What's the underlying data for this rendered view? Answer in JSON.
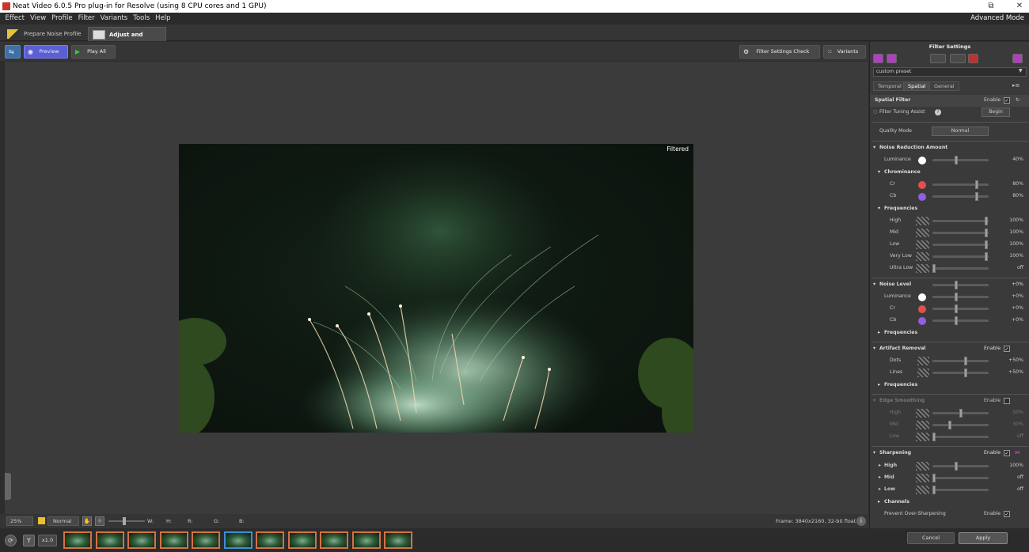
{
  "window": {
    "title": "Neat Video 6.0.5 Pro plug-in for Resolve (using 8 CPU cores and 1 GPU)",
    "restore_glyph": "⧉",
    "close_glyph": "✕"
  },
  "menu": [
    "Effect",
    "View",
    "Profile",
    "Filter",
    "Variants",
    "Tools",
    "Help"
  ],
  "mode_label": "Advanced Mode",
  "tabs": {
    "prepare": "Prepare Noise Profile",
    "adjust": "Adjust and Preview"
  },
  "toolbar": {
    "preview": "Preview",
    "play_all": "Play All",
    "filter_check": "Filter Settings Check",
    "variants": "Variants"
  },
  "viewer": {
    "label": "Filtered"
  },
  "bottom": {
    "zoom": "25%",
    "mode": "Normal",
    "w": "W:",
    "h": "H:",
    "r": "R:",
    "g": "G:",
    "b": "B:",
    "frame": "Frame: 3840x2160, 32-bit float"
  },
  "filmstrip": {
    "speed": "x1.0",
    "thumb_count": 11,
    "selected_index": 5,
    "cancel": "Cancel",
    "apply": "Apply"
  },
  "panel": {
    "header": "Filter Settings",
    "preset": "custom preset",
    "tabs": [
      "Temporal",
      "Spatial",
      "General"
    ],
    "spatial_filter": "Spatial Filter",
    "enable": "Enable",
    "tuning": "Filter Tuning Assist",
    "begin": "Begin",
    "quality_label": "Quality Mode",
    "quality_value": "Normal",
    "nr_header": "Noise Reduction Amount",
    "luminance": "Luminance",
    "lum_value": "40%",
    "chrominance": "Chrominance",
    "cr": "Cr",
    "cr_value": "80%",
    "cb": "Cb",
    "cb_value": "80%",
    "frequencies": "Frequencies",
    "freq": [
      {
        "l": "High",
        "v": "100%"
      },
      {
        "l": "Mid",
        "v": "100%"
      },
      {
        "l": "Low",
        "v": "100%"
      },
      {
        "l": "Very Low",
        "v": "100%"
      },
      {
        "l": "Ultra Low",
        "v": "off"
      }
    ],
    "noise_level": "Noise Level",
    "nl_value": "+0%",
    "nl_rows": [
      {
        "l": "Luminance",
        "v": "+0%"
      },
      {
        "l": "Cr",
        "v": "+0%"
      },
      {
        "l": "Cb",
        "v": "+0%"
      }
    ],
    "artifact": "Artifact Removal",
    "dots": "Dots",
    "dots_v": "+50%",
    "lines": "Lines",
    "lines_v": "+50%",
    "edge": "Edge Smoothing",
    "edge_rows": [
      {
        "l": "High",
        "v": "50%"
      },
      {
        "l": "Mid",
        "v": "30%"
      },
      {
        "l": "Low",
        "v": "off"
      }
    ],
    "sharpening": "Sharpening",
    "sharp_rows": [
      {
        "l": "High",
        "v": "100%"
      },
      {
        "l": "Mid",
        "v": "off"
      },
      {
        "l": "Low",
        "v": "off"
      }
    ],
    "channels": "Channels",
    "prevent": "Prevent Over-Sharpening",
    "check_glyph": "✓"
  },
  "colors": {
    "accent": "#5a5fd6",
    "cr": "#e05050",
    "cb": "#9060e0",
    "thumb_border": "#d47240",
    "selected_border": "#3a8fd8"
  }
}
